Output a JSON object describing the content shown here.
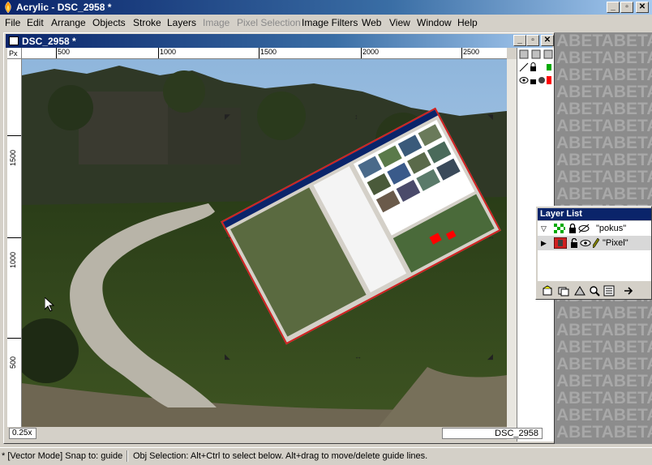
{
  "app": {
    "title": "Acrylic - DSC_2958 *",
    "window_buttons": [
      "_",
      "▫",
      "✕"
    ]
  },
  "menu": [
    {
      "label": "File",
      "disabled": false
    },
    {
      "label": "Edit",
      "disabled": false
    },
    {
      "label": "Arrange",
      "disabled": false
    },
    {
      "label": "Objects",
      "disabled": false
    },
    {
      "label": "Stroke",
      "disabled": false
    },
    {
      "label": "Layers",
      "disabled": false
    },
    {
      "label": "Image",
      "disabled": true
    },
    {
      "label": "Pixel Selection",
      "disabled": true
    },
    {
      "label": "Image Filters",
      "disabled": false
    },
    {
      "label": "Web",
      "disabled": false
    },
    {
      "label": "View",
      "disabled": false
    },
    {
      "label": "Window",
      "disabled": false
    },
    {
      "label": "Help",
      "disabled": false
    }
  ],
  "document": {
    "title": "DSC_2958 *",
    "ruler_unit": "Px",
    "ruler_top_labels": [
      "500",
      "1000",
      "1500",
      "2000",
      "2500"
    ],
    "ruler_left_labels": [
      "1500",
      "1000",
      "500"
    ],
    "zoom": "0.25x",
    "name": "DSC_2958"
  },
  "watermark": "ABETABETA",
  "layer_list": {
    "title": "Layer List",
    "layers": [
      {
        "name": "\"pokus\"",
        "expanded": true,
        "selected": false
      },
      {
        "name": "\"Pixel\"",
        "expanded": false,
        "selected": true
      }
    ]
  },
  "statusbar": {
    "mode": "* [Vector Mode] Snap to: guide",
    "hint": "Obj Selection: Alt+Ctrl to select below. Alt+drag to move/delete guide lines."
  },
  "colors": {
    "titlebar": "#0a246a",
    "accent_red": "#ff0000",
    "selection_red": "#d02020"
  }
}
